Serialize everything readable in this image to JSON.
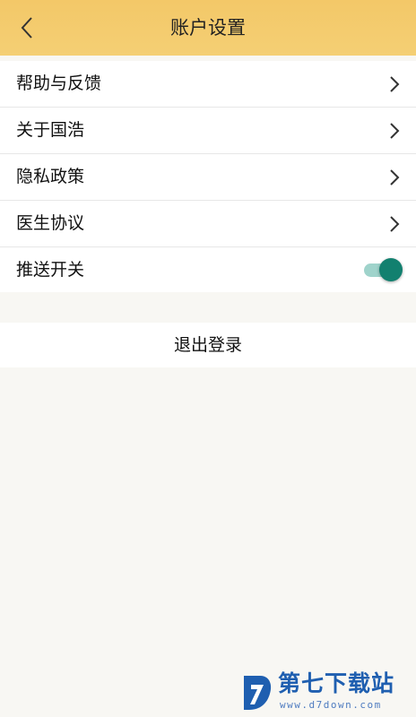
{
  "header": {
    "title": "账户设置",
    "back_icon": "chevron-left-icon",
    "background": "#f3c868"
  },
  "menu": {
    "items": [
      {
        "label": "帮助与反馈",
        "icon": "chevron-right-icon"
      },
      {
        "label": "关于国浩",
        "icon": "chevron-right-icon"
      },
      {
        "label": "隐私政策",
        "icon": "chevron-right-icon"
      },
      {
        "label": "医生协议",
        "icon": "chevron-right-icon"
      }
    ],
    "push_toggle": {
      "label": "推送开关",
      "on": true,
      "color": "#12806f"
    }
  },
  "logout": {
    "label": "退出登录"
  },
  "watermark": {
    "title": "第七下载站",
    "url": "www.d7down.com"
  }
}
